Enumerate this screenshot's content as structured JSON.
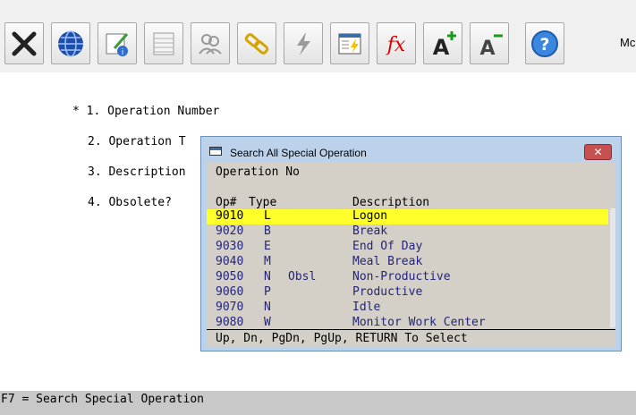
{
  "toolbar": {
    "buttons": [
      {
        "name": "close-icon",
        "icon": "x"
      },
      {
        "name": "globe-icon",
        "icon": "globe"
      },
      {
        "name": "info-edit-icon",
        "icon": "info"
      },
      {
        "name": "grid-icon",
        "icon": "grid"
      },
      {
        "name": "users-icon",
        "icon": "users"
      },
      {
        "name": "link-icon",
        "icon": "link"
      },
      {
        "name": "lightning-icon",
        "icon": "bolt"
      },
      {
        "name": "form-lightning-icon",
        "icon": "form"
      },
      {
        "name": "function-icon",
        "icon": "fx"
      },
      {
        "name": "font-increase-icon",
        "icon": "A+"
      },
      {
        "name": "font-decrease-icon",
        "icon": "A-"
      },
      {
        "name": "help-icon",
        "icon": "?"
      }
    ],
    "more_label": "Mc"
  },
  "fields": {
    "f1": "* 1. Operation Number",
    "f2": "2. Operation T",
    "f3": "3. Description",
    "f4": "4. Obsolete?"
  },
  "dialog": {
    "title": "Search All Special Operation",
    "close": "✕",
    "prompt": "Operation No",
    "headers": {
      "op": "Op#",
      "type": "Type",
      "desc": "Description"
    },
    "rows": [
      {
        "op": "9010",
        "type": "L",
        "obsl": "",
        "desc": "Logon",
        "selected": true
      },
      {
        "op": "9020",
        "type": "B",
        "obsl": "",
        "desc": "Break"
      },
      {
        "op": "9030",
        "type": "E",
        "obsl": "",
        "desc": "End Of Day"
      },
      {
        "op": "9040",
        "type": "M",
        "obsl": "",
        "desc": "Meal Break"
      },
      {
        "op": "9050",
        "type": "N",
        "obsl": "Obsl",
        "desc": "Non-Productive"
      },
      {
        "op": "9060",
        "type": "P",
        "obsl": "",
        "desc": "Productive"
      },
      {
        "op": "9070",
        "type": "N",
        "obsl": "",
        "desc": "Idle"
      },
      {
        "op": "9080",
        "type": "W",
        "obsl": "",
        "desc": "Monitor Work Center"
      }
    ],
    "footer": "Up, Dn, PgDn, PgUp, RETURN To Select"
  },
  "status_bar": "F7 = Search Special Operation",
  "colors": {
    "selection": "#ffff2a",
    "row_text": "#24247a",
    "dialog_frame": "#bcd2ea"
  }
}
